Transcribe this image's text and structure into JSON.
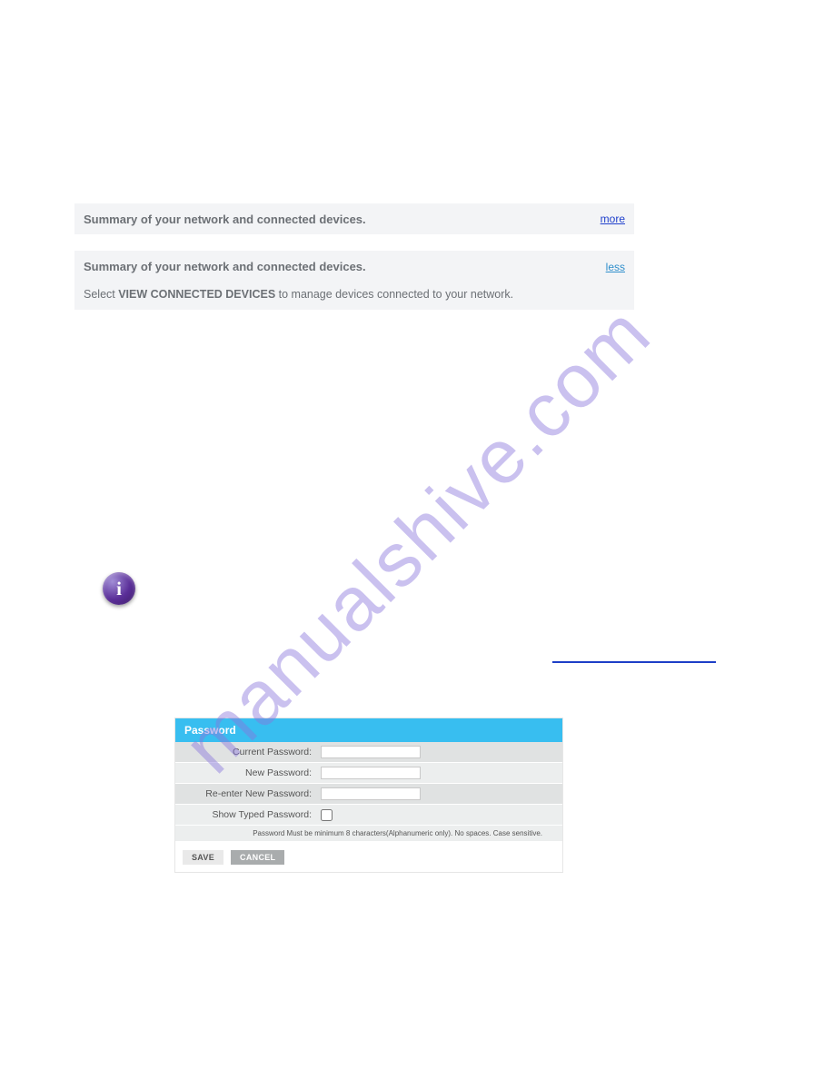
{
  "watermark": "manualshive.com",
  "panel_collapsed": {
    "title": "Summary of your network and connected devices.",
    "toggle": "more"
  },
  "panel_expanded": {
    "title": "Summary of your network and connected devices.",
    "toggle": "less",
    "body_prefix": "Select ",
    "body_strong": "VIEW CONNECTED DEVICES",
    "body_suffix": " to manage devices connected to your network."
  },
  "info_icon_glyph": "i",
  "password_form": {
    "header": "Password",
    "rows": {
      "current": {
        "label": "Current Password:",
        "value": ""
      },
      "new": {
        "label": "New Password:",
        "value": ""
      },
      "reenter": {
        "label": "Re-enter New Password:",
        "value": ""
      },
      "show": {
        "label": "Show Typed Password:"
      }
    },
    "hint": "Password Must be minimum 8 characters(Alphanumeric only). No spaces. Case sensitive.",
    "save_label": "SAVE",
    "cancel_label": "CANCEL"
  }
}
